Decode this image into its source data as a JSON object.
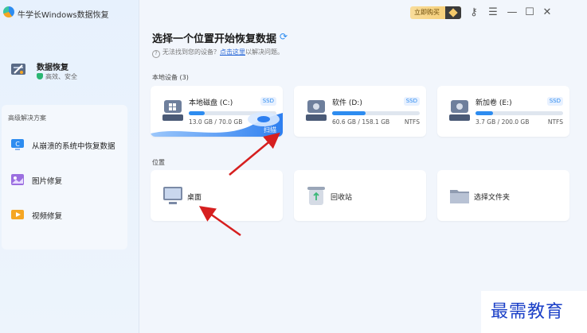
{
  "app": {
    "title": "牛学长Windows数据恢复"
  },
  "sidebar": {
    "main_item": {
      "label": "数据恢复",
      "subtitle": "高效、安全"
    },
    "advanced": {
      "title": "高级解决方案",
      "items": [
        {
          "label": "从崩溃的系统中恢复数据"
        },
        {
          "label": "图片修复"
        },
        {
          "label": "视频修复"
        }
      ]
    }
  },
  "topbar": {
    "buy_label": "立即购买"
  },
  "main": {
    "heading": "选择一个位置开始恢复数据",
    "hint": {
      "prefix": "无法找到您的设备？",
      "link": "点击这里",
      "suffix": "以解决问题。"
    },
    "local_devices_label": "本地设备",
    "local_devices_count": "(3)",
    "drives": [
      {
        "name": "本地磁盘 (C:)",
        "type": "SSD",
        "size": "13.0 GB / 70.0 GB",
        "fs": "",
        "used_fraction": 0.186,
        "scan_label": "扫描"
      },
      {
        "name": "软件 (D:)",
        "type": "SSD",
        "size": "60.6 GB / 158.1 GB",
        "fs": "NTFS",
        "used_fraction": 0.383
      },
      {
        "name": "新加卷 (E:)",
        "type": "SSD",
        "size": "3.7 GB / 200.0 GB",
        "fs": "NTFS",
        "used_fraction": 0.2
      }
    ],
    "locations_label": "位置",
    "locations": [
      {
        "name": "桌面"
      },
      {
        "name": "回收站"
      },
      {
        "name": "选择文件夹"
      }
    ]
  },
  "watermark": "最需教育",
  "colors": {
    "accent": "#2d8cf0",
    "arrow": "#d61f1f",
    "watermark": "#1a3fc7"
  }
}
